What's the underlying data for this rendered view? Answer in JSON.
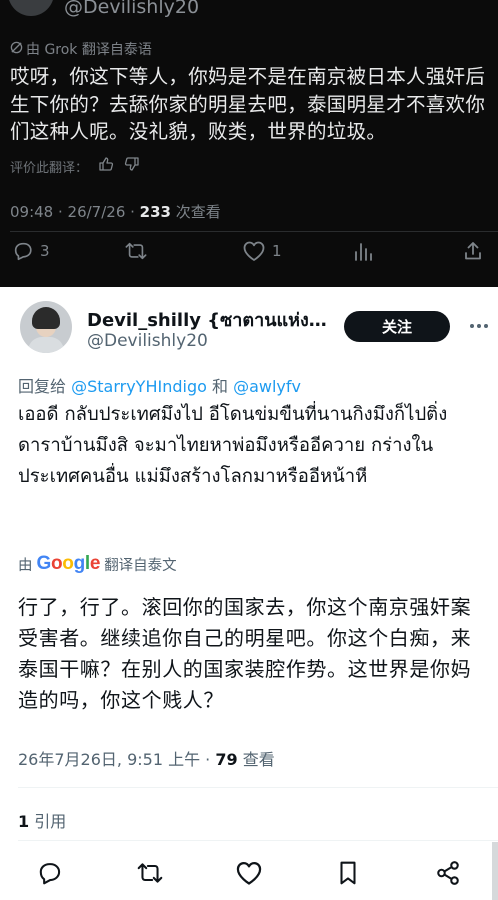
{
  "top_tweet": {
    "handle": "@Devilishly20",
    "translated_by": "由 Grok 翻译自泰语",
    "text": "哎呀，你这下等人，你妈是不是在南京被日本人强奸后生下你的？去舔你家的明星去吧，泰国明星才不喜欢你们这种人呢。没礼貌，败类，世界的垃圾。",
    "rate_label": "评价此翻译：",
    "meta_prefix": "09:48 · 26/7/26 · ",
    "views_count": "233",
    "views_label": " 次查看",
    "reply_count": "3",
    "like_count": "1"
  },
  "post": {
    "display_name": "Devil_shilly {ซาตานแห่งก...",
    "handle": "@Devilishly20",
    "follow_label": "关注",
    "reply_prefix": "回复给 ",
    "reply_to_1": "@StarryYHIndigo",
    "reply_and": " 和 ",
    "reply_to_2": "@awlyfv",
    "text_thai": "เออดี กลับประเทศมึงไป อีโดนข่มขืนที่นานกิงมึงก็ไปติ่งดาราบ้านมึงสิ จะมาไทยหาพ่อมึงหรืออีควาย กร่างในประเทศคนอื่น แม่มึงสร้างโลกมาหรืออีหน้าหี",
    "translate_prefix": "由",
    "translate_suffix": "翻译自泰文",
    "text_translated": "行了，行了。滚回你的国家去，你这个南京强奸案受害者。继续追你自己的明星吧。你这个白痴，来泰国干嘛？在别人的国家装腔作势。这世界是你妈造的吗，你这个贱人？",
    "meta_prefix": "26年7月26日, 9:51 上午 · ",
    "views_count": "79",
    "views_label": " 查看",
    "quote_count": "1",
    "quote_label": " 引用"
  },
  "icons": [
    "grok-icon",
    "thumbs-up-icon",
    "thumbs-down-icon",
    "reply-icon",
    "retweet-icon",
    "like-icon",
    "bookmark-icon",
    "share-icon",
    "more-icon",
    "google-logo"
  ]
}
